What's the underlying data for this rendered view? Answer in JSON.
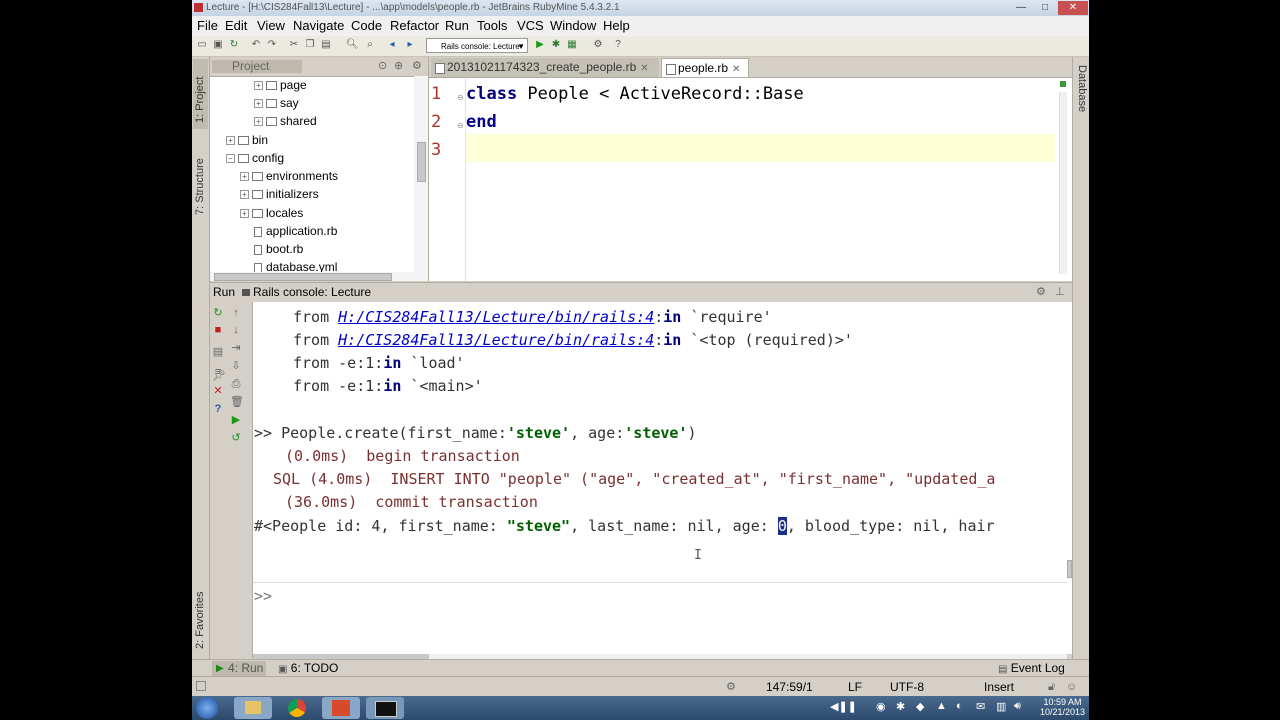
{
  "window": {
    "title": "Lecture - [H:\\CIS284Fall13\\Lecture] - ...\\app\\models\\people.rb - JetBrains RubyMine 5.4.3.2.1",
    "min": "—",
    "max": "□",
    "close": "✕"
  },
  "menu": [
    "File",
    "Edit",
    "View",
    "Navigate",
    "Code",
    "Refactor",
    "Run",
    "Tools",
    "VCS",
    "Window",
    "Help"
  ],
  "toolbar": {
    "run_config": "Rails console: Lecture"
  },
  "left_strip": {
    "project": "1: Project",
    "structure": "7: Structure",
    "favorites": "2: Favorites"
  },
  "right_strip": {
    "database": "Database"
  },
  "project_pane": {
    "title": "Project",
    "tree": [
      {
        "label": "page",
        "type": "folder"
      },
      {
        "label": "say",
        "type": "folder"
      },
      {
        "label": "shared",
        "type": "folder"
      },
      {
        "label": "bin",
        "type": "folder"
      },
      {
        "label": "config",
        "type": "folder"
      },
      {
        "label": "environments",
        "type": "folder"
      },
      {
        "label": "initializers",
        "type": "folder"
      },
      {
        "label": "locales",
        "type": "folder"
      },
      {
        "label": "application.rb",
        "type": "file"
      },
      {
        "label": "boot.rb",
        "type": "file"
      },
      {
        "label": "database.yml",
        "type": "file"
      }
    ]
  },
  "editor": {
    "tabs": [
      {
        "label": "20131021174323_create_people.rb",
        "active": false
      },
      {
        "label": "people.rb",
        "active": true
      }
    ],
    "lines": [
      {
        "num": "1",
        "kw": "class",
        "rest": " People < ActiveRecord::Base"
      },
      {
        "num": "2",
        "kw": "end",
        "rest": ""
      },
      {
        "num": "3",
        "kw": "",
        "rest": ""
      }
    ]
  },
  "run_panel": {
    "label": "Run",
    "config": "Rails console: Lecture",
    "console": {
      "from": "from",
      "in": "in",
      "line1_path": "H:/CIS284Fall13/Lecture/bin/rails:4",
      "line1_rest": " `require'",
      "line2_path": "H:/CIS284Fall13/Lecture/bin/rails:4",
      "line2_rest": " `<top (required)>'",
      "line3_pre": "from -e:1:",
      "line3_rest": " `load'",
      "line4_pre": "from -e:1:",
      "line4_rest": " `<main>'",
      "prompt": ">>",
      "cmd_pre": " People.create(first_name:",
      "cmd_str1": "'steve'",
      "cmd_mid": ", age:",
      "cmd_str2": "'steve'",
      "cmd_end": ")",
      "begin_line": "(0.0ms)  begin transaction",
      "sql_line": "SQL (4.0ms)  INSERT INTO \"people\" (\"age\", \"created_at\", \"first_name\", \"updated_a",
      "commit_line": "(36.0ms)  commit transaction",
      "result_pre": "#<People id: 4, first_name: ",
      "result_str": "\"steve\"",
      "result_mid": ", last_name: nil, age: ",
      "result_sel": "0",
      "result_end": ", blood_type: nil, hair",
      "empty_prompt": ">>"
    }
  },
  "bottom_tabs": {
    "run": "4: Run",
    "todo": "6: TODO",
    "event_log": "Event Log"
  },
  "status": {
    "position": "147:59/1",
    "line_sep": "LF",
    "encoding": "UTF-8",
    "mode": "Insert"
  },
  "taskbar": {
    "time": "10:59 AM",
    "date": "10/21/2013"
  }
}
